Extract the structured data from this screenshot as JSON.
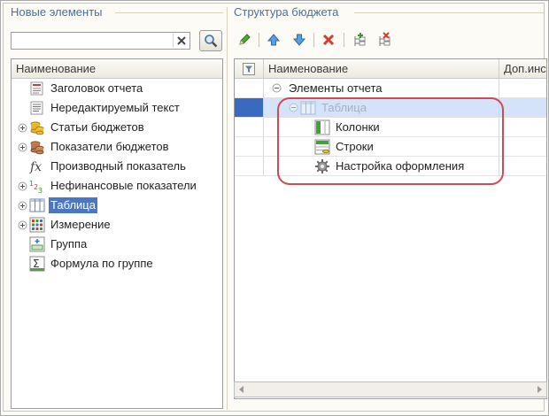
{
  "left_panel": {
    "title": "Новые элементы",
    "search": {
      "value": "",
      "placeholder": ""
    },
    "column_header": "Наименование",
    "items": [
      {
        "label": "Заголовок отчета",
        "icon": "report-header-icon",
        "expandable": false,
        "selected": false
      },
      {
        "label": "Нередактируемый текст",
        "icon": "text-block-icon",
        "expandable": false,
        "selected": false
      },
      {
        "label": "Статьи бюджетов",
        "icon": "coins-icon",
        "expandable": true,
        "selected": false
      },
      {
        "label": "Показатели бюджетов",
        "icon": "coins-stack-icon",
        "expandable": true,
        "selected": false
      },
      {
        "label": "Производный показатель",
        "icon": "fx-icon",
        "expandable": false,
        "selected": false
      },
      {
        "label": "Нефинансовые показатели",
        "icon": "numbers-icon",
        "expandable": true,
        "selected": false
      },
      {
        "label": "Таблица",
        "icon": "table-icon",
        "expandable": true,
        "selected": true
      },
      {
        "label": "Измерение",
        "icon": "grid-icon",
        "expandable": true,
        "selected": false
      },
      {
        "label": "Группа",
        "icon": "group-icon",
        "expandable": false,
        "selected": false
      },
      {
        "label": "Формула по группе",
        "icon": "sigma-icon",
        "expandable": false,
        "selected": false
      }
    ]
  },
  "right_panel": {
    "title": "Структура бюджета",
    "toolbar": [
      "edit-pencil-icon",
      "move-up-icon",
      "move-down-icon",
      "delete-icon",
      "add-element-icon",
      "remove-element-icon"
    ],
    "columns": [
      "Наименование",
      "Доп.инс"
    ],
    "rows": [
      {
        "label": "Элементы отчета",
        "icon": "",
        "expander": "collapse",
        "level": 0,
        "selected": false
      },
      {
        "label": "Таблица",
        "icon": "table-icon",
        "expander": "collapse",
        "level": 1,
        "selected": true
      },
      {
        "label": "Колонки",
        "icon": "columns-icon",
        "expander": "",
        "level": 2,
        "selected": false
      },
      {
        "label": "Строки",
        "icon": "rows-icon",
        "expander": "",
        "level": 2,
        "selected": false
      },
      {
        "label": "Настройка оформления",
        "icon": "gear-icon",
        "expander": "",
        "level": 2,
        "selected": false
      }
    ]
  },
  "colors": {
    "selection": "#4a76c4",
    "highlight_ring": "#cf4a52",
    "section_title": "#4a6fa0"
  }
}
